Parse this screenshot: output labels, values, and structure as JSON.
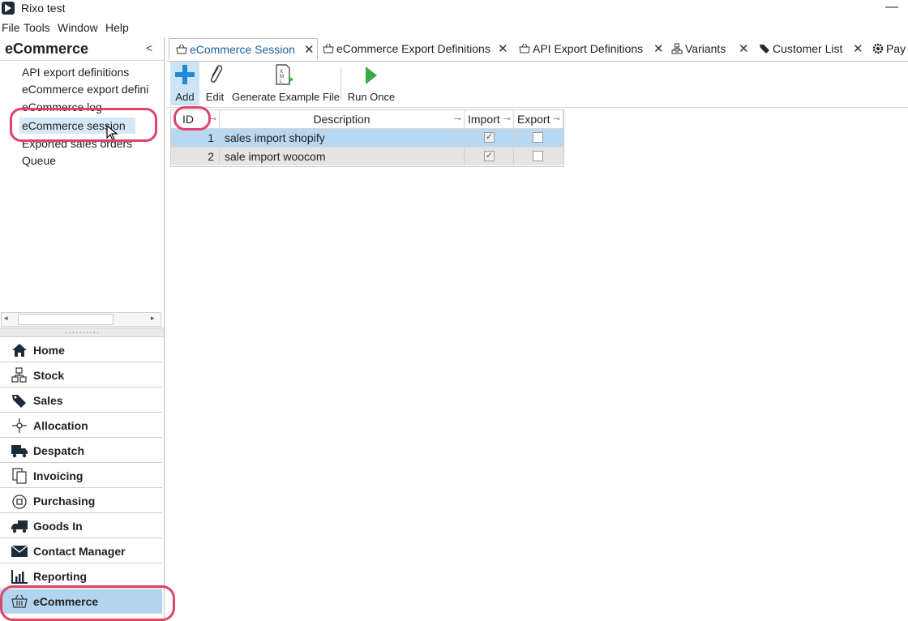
{
  "window": {
    "title": "Rixo test",
    "minimize": "—"
  },
  "menu": [
    "File",
    "Tools",
    "Window",
    "Help"
  ],
  "nav": {
    "title": "eCommerce",
    "collapse": "<",
    "tree": [
      "API export definitions",
      "eCommerce export defini",
      "eCommerce log",
      "eCommerce session",
      "Exported sales orders",
      "Queue"
    ],
    "selected_index": 3,
    "modules": [
      {
        "label": "Home",
        "icon": "home-icon"
      },
      {
        "label": "Stock",
        "icon": "stock-icon"
      },
      {
        "label": "Sales",
        "icon": "sales-tag-icon"
      },
      {
        "label": "Allocation",
        "icon": "allocation-icon"
      },
      {
        "label": "Despatch",
        "icon": "truck-icon"
      },
      {
        "label": "Invoicing",
        "icon": "invoice-icon"
      },
      {
        "label": "Purchasing",
        "icon": "purchasing-icon"
      },
      {
        "label": "Goods In",
        "icon": "goods-in-icon"
      },
      {
        "label": "Contact Manager",
        "icon": "envelope-icon"
      },
      {
        "label": "Reporting",
        "icon": "bar-chart-icon"
      },
      {
        "label": "eCommerce",
        "icon": "basket-icon"
      }
    ],
    "active_module": "eCommerce"
  },
  "tabs": [
    {
      "label": "eCommerce Session",
      "icon": "basket-icon",
      "close": "✕",
      "active": true
    },
    {
      "label": "eCommerce Export Definitions",
      "icon": "basket-icon",
      "close": "✕"
    },
    {
      "label": "API Export Definitions",
      "icon": "basket-icon",
      "close": "✕"
    },
    {
      "label": "Variants",
      "icon": "stock-icon",
      "close": "✕"
    },
    {
      "label": "Customer List",
      "icon": "sales-tag-icon",
      "close": "✕"
    },
    {
      "label": "Pay",
      "icon": "gear-icon"
    }
  ],
  "toolbar": {
    "add": "Add",
    "edit": "Edit",
    "generate": "Generate Example File",
    "run": "Run Once"
  },
  "grid": {
    "columns": [
      "ID",
      "Description",
      "Import",
      "Export"
    ],
    "rows": [
      {
        "id": "1",
        "description": "sales import shopify",
        "import": true,
        "export": false
      },
      {
        "id": "2",
        "description": "sale import woocom",
        "import": true,
        "export": false
      }
    ]
  },
  "colors": {
    "accent": "#1a5fa5",
    "selection": "#b8d8f1",
    "highlight": "#e0436a",
    "add_icon": "#1f8ad6",
    "run_icon": "#3aa845"
  }
}
